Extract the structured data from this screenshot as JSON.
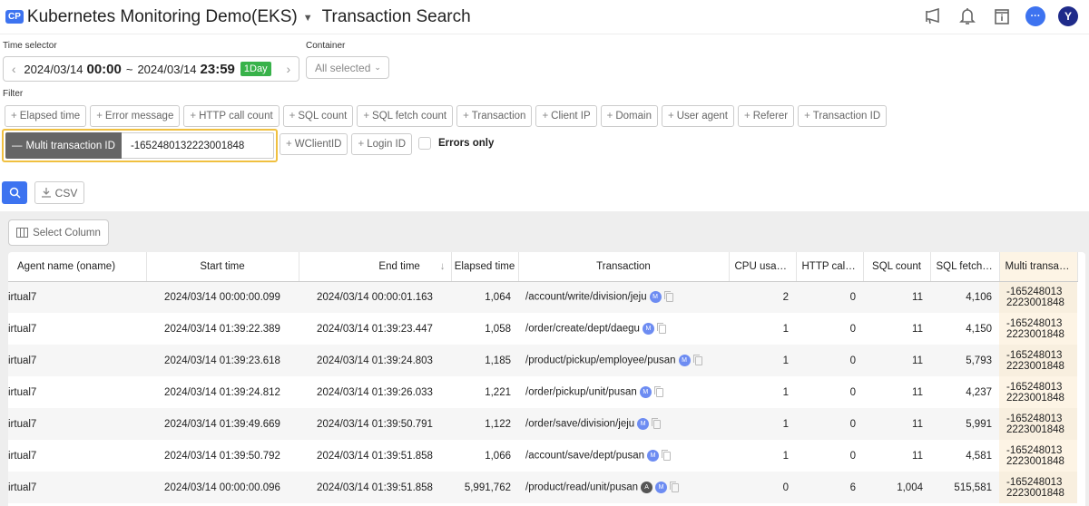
{
  "header": {
    "project_badge": "CP",
    "project_name": "Kubernetes Monitoring Demo(EKS)",
    "page_title": "Transaction Search",
    "icons": [
      "megaphone-icon",
      "bell-icon",
      "info-book-icon",
      "chat-icon",
      "avatar"
    ],
    "chat_icon_text": "···",
    "avatar_initial": "Y"
  },
  "time_selector": {
    "label": "Time selector",
    "start_date": "2024/03/14",
    "start_time": "00:00",
    "separator": "~",
    "end_date": "2024/03/14",
    "end_time": "23:59",
    "range_badge": "1Day",
    "prev": "‹",
    "next": "›"
  },
  "container": {
    "label": "Container",
    "value": "All selected"
  },
  "filter": {
    "label": "Filter",
    "chips_row1": [
      "Elapsed time",
      "Error message",
      "HTTP call count",
      "SQL count",
      "SQL fetch count",
      "Transaction",
      "Client IP",
      "Domain",
      "User agent",
      "Referer",
      "Transaction ID"
    ],
    "active_filter": {
      "label": "Multi transaction ID",
      "value": "-1652480132223001848"
    },
    "chips_row2": [
      "WClientID",
      "Login ID"
    ],
    "errors_only_label": "Errors only",
    "errors_only_checked": false
  },
  "actions": {
    "csv_label": "CSV",
    "select_column_label": "Select Column"
  },
  "table": {
    "columns": [
      "Agent name (oname)",
      "Start time",
      "End time",
      "Elapsed time",
      "Transaction",
      "CPU usage...",
      "HTTP call ...",
      "SQL count",
      "SQL fetch ...",
      "Multi transacti..."
    ],
    "sorted_column": "End time",
    "sort_direction": "desc",
    "rows": [
      {
        "agent": "irtual7",
        "start": "2024/03/14 00:00:00.099",
        "end": "2024/03/14 00:00:01.163",
        "elapsed": "1,064",
        "transaction": "/account/write/division/jeju",
        "badges": [
          "M"
        ],
        "cpu": "2",
        "http": "0",
        "sql": "11",
        "fetch": "4,106",
        "mtid1": "-165248013",
        "mtid2": "2223001848"
      },
      {
        "agent": "irtual7",
        "start": "2024/03/14 01:39:22.389",
        "end": "2024/03/14 01:39:23.447",
        "elapsed": "1,058",
        "transaction": "/order/create/dept/daegu",
        "badges": [
          "M"
        ],
        "cpu": "1",
        "http": "0",
        "sql": "11",
        "fetch": "4,150",
        "mtid1": "-165248013",
        "mtid2": "2223001848"
      },
      {
        "agent": "irtual7",
        "start": "2024/03/14 01:39:23.618",
        "end": "2024/03/14 01:39:24.803",
        "elapsed": "1,185",
        "transaction": "/product/pickup/employee/pusan",
        "badges": [
          "M"
        ],
        "cpu": "1",
        "http": "0",
        "sql": "11",
        "fetch": "5,793",
        "mtid1": "-165248013",
        "mtid2": "2223001848"
      },
      {
        "agent": "irtual7",
        "start": "2024/03/14 01:39:24.812",
        "end": "2024/03/14 01:39:26.033",
        "elapsed": "1,221",
        "transaction": "/order/pickup/unit/pusan",
        "badges": [
          "M"
        ],
        "cpu": "1",
        "http": "0",
        "sql": "11",
        "fetch": "4,237",
        "mtid1": "-165248013",
        "mtid2": "2223001848"
      },
      {
        "agent": "irtual7",
        "start": "2024/03/14 01:39:49.669",
        "end": "2024/03/14 01:39:50.791",
        "elapsed": "1,122",
        "transaction": "/order/save/division/jeju",
        "badges": [
          "M"
        ],
        "cpu": "1",
        "http": "0",
        "sql": "11",
        "fetch": "5,991",
        "mtid1": "-165248013",
        "mtid2": "2223001848"
      },
      {
        "agent": "irtual7",
        "start": "2024/03/14 01:39:50.792",
        "end": "2024/03/14 01:39:51.858",
        "elapsed": "1,066",
        "transaction": "/account/save/dept/pusan",
        "badges": [
          "M"
        ],
        "cpu": "1",
        "http": "0",
        "sql": "11",
        "fetch": "4,581",
        "mtid1": "-165248013",
        "mtid2": "2223001848"
      },
      {
        "agent": "irtual7",
        "start": "2024/03/14 00:00:00.096",
        "end": "2024/03/14 01:39:51.858",
        "elapsed": "5,991,762",
        "transaction": "/product/read/unit/pusan",
        "badges": [
          "A",
          "M"
        ],
        "cpu": "0",
        "http": "6",
        "sql": "1,004",
        "fetch": "515,581",
        "mtid1": "-165248013",
        "mtid2": "2223001848"
      }
    ]
  },
  "colors": {
    "accent": "#3d73f0",
    "day_badge": "#38b24a",
    "highlight_border": "#f0c040",
    "highlight_column": "#fdf4e5"
  }
}
